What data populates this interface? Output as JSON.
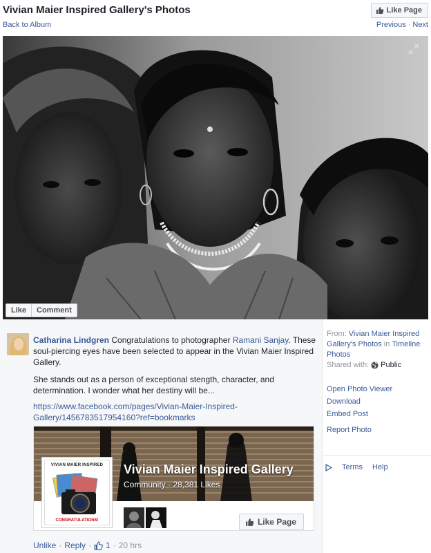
{
  "header": {
    "title": "Vivian Maier Inspired Gallery's Photos",
    "like_page_label": "Like Page",
    "back_label": "Back to Album",
    "previous_label": "Previous",
    "separator": "·",
    "next_label": "Next"
  },
  "photo": {
    "like_label": "Like",
    "comment_label": "Comment"
  },
  "post": {
    "author": "Catharina Lindgren",
    "text_before_tag": " Congratulations to photographer ",
    "tagged": "Ramani Sanjay",
    "text_after_tag": ". These soul-piercing eyes have been selected to appear in the Vivian Maier Inspired Gallery.",
    "paragraph2": "She stands out as a person of exceptional stength, character, and determination. I wonder what her destiny will be...",
    "url": "https://www.facebook.com/pages/Vivian-Maier-Inspired-Gallery/1456783517954160?ref=bookmarks"
  },
  "card": {
    "thumb_top": "VIVIAN MAIER INSPIRED",
    "thumb_bottom": "CONGRATULATIONS!",
    "name": "Vivian Maier Inspired Gallery",
    "meta": "Community · 28,381 Likes",
    "like_label": "Like Page"
  },
  "actions": {
    "unlike": "Unlike",
    "dot1": "·",
    "reply": "Reply",
    "dot2": "·",
    "like_count": "1",
    "dot3": "·",
    "time": "20 hrs"
  },
  "sidebar": {
    "from_label": "From: ",
    "from_link": "Vivian Maier Inspired Gallery's Photos",
    "in_label": " in ",
    "in_link": "Timeline Photos",
    "shared_label": "Shared with:",
    "shared_value": "Public",
    "links": [
      "Open Photo Viewer",
      "Download",
      "Embed Post"
    ],
    "report": "Report Photo",
    "footer": {
      "terms": "Terms",
      "help": "Help"
    }
  },
  "colors": {
    "link": "#3b5998",
    "muted": "#90949c",
    "panel_bg": "#f6f7f9"
  }
}
